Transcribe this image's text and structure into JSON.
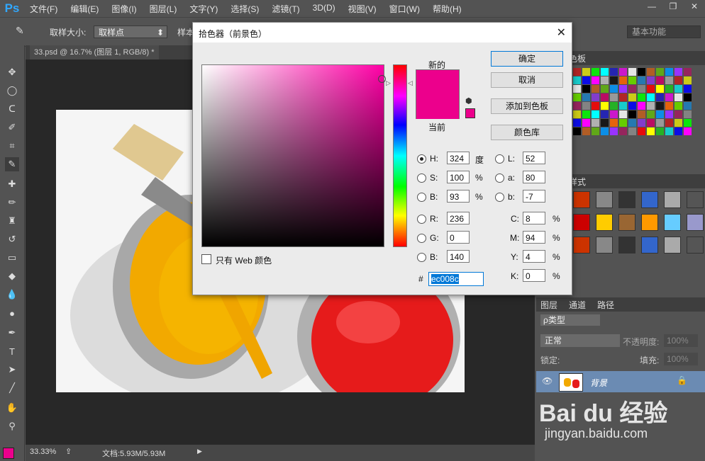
{
  "app": {
    "logo": "Ps"
  },
  "menu": [
    "文件(F)",
    "编辑(E)",
    "图像(I)",
    "图层(L)",
    "文字(Y)",
    "选择(S)",
    "滤镜(T)",
    "3D(D)",
    "视图(V)",
    "窗口(W)",
    "帮助(H)"
  ],
  "window_controls": {
    "minimize": "—",
    "restore": "❐",
    "close": "✕"
  },
  "options": {
    "sample_size_label": "取样大小:",
    "sample_size_value": "取样点",
    "sample_label": "样本",
    "workspace": "基本功能"
  },
  "document": {
    "tab": "33.psd @ 16.7% (图层 1, RGB/8) *",
    "zoom": "33.33%",
    "doc_info": "文档:5.93M/5.93M"
  },
  "panels": {
    "swatches_tab": "色板",
    "styles_tab": "样式",
    "layers_tab": "图层",
    "channels_tab": "通道",
    "paths_tab": "路径",
    "kind_filter": "ρ类型",
    "blend_mode": "正常",
    "opacity_label": "不透明度:",
    "opacity_value": "100%",
    "lock_label": "锁定:",
    "fill_label": "填充:",
    "fill_value": "100%",
    "layer_name": "背景"
  },
  "dialog": {
    "title": "拾色器（前景色）",
    "close": "✕",
    "ok": "确定",
    "cancel": "取消",
    "add_to_swatches": "添加到色板",
    "color_libraries": "颜色库",
    "new_label": "新的",
    "current_label": "当前",
    "new_color": "#ec008c",
    "current_color": "#ec008c",
    "web_only": "只有 Web 颜色",
    "fields": {
      "H": {
        "label": "H:",
        "value": "324",
        "unit": "度"
      },
      "S": {
        "label": "S:",
        "value": "100",
        "unit": "%"
      },
      "Bv": {
        "label": "B:",
        "value": "93",
        "unit": "%"
      },
      "R": {
        "label": "R:",
        "value": "236"
      },
      "G": {
        "label": "G:",
        "value": "0"
      },
      "Bc": {
        "label": "B:",
        "value": "140"
      },
      "L": {
        "label": "L:",
        "value": "52"
      },
      "a": {
        "label": "a:",
        "value": "80"
      },
      "b": {
        "label": "b:",
        "value": "-7"
      },
      "C": {
        "label": "C:",
        "value": "8",
        "unit": "%"
      },
      "M": {
        "label": "M:",
        "value": "94",
        "unit": "%"
      },
      "Y": {
        "label": "Y:",
        "value": "4",
        "unit": "%"
      },
      "K": {
        "label": "K:",
        "value": "0",
        "unit": "%"
      }
    },
    "hex_label": "#",
    "hex_value": "ec008c"
  },
  "watermark": {
    "brand": "Bai du 经验",
    "url": "jingyan.baidu.com"
  },
  "colors": {
    "foreground": "#ec008c",
    "accent": "#0078d7"
  }
}
